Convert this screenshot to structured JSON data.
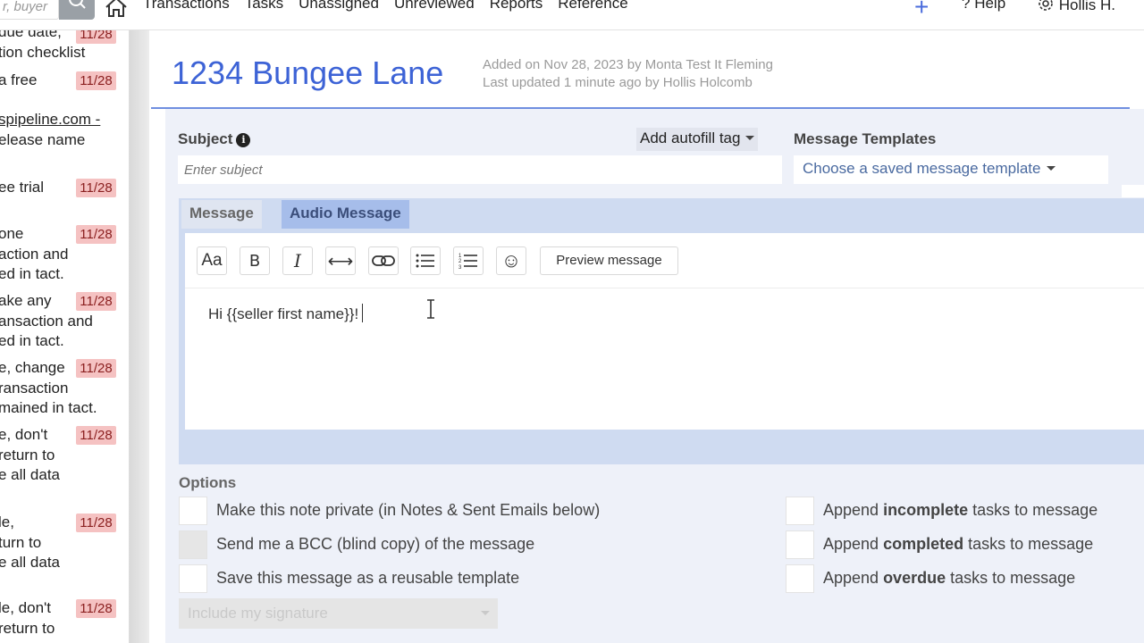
{
  "topnav": {
    "search_placeholder": "r, buyer",
    "links": [
      "Transactions",
      "Tasks",
      "Unassigned",
      "Unreviewed",
      "Reports",
      "Reference"
    ],
    "plus": "+",
    "help": "Help",
    "user": "Hollis H."
  },
  "task_list": [
    {
      "lines": [
        "due date,",
        "tion checklist"
      ],
      "date": "11/28"
    },
    {
      "lines": [
        "a free"
      ],
      "date": "11/28"
    },
    {
      "lines": [
        "spipeline.com -",
        "elease name"
      ],
      "date": ""
    },
    {
      "lines": [
        "ee trial"
      ],
      "date": "11/28"
    },
    {
      "lines": [
        "one",
        "action and",
        "ed in tact."
      ],
      "date": "11/28"
    },
    {
      "lines": [
        "ake any",
        "ansaction and",
        "ed in tact."
      ],
      "date": "11/28"
    },
    {
      "lines": [
        "e, change",
        "ransaction",
        "mained in tact."
      ],
      "date": "11/28"
    },
    {
      "lines": [
        "e, don't",
        "return to",
        "e all data"
      ],
      "date": "11/28"
    },
    {
      "lines": [
        "le,",
        "turn to",
        "e all data"
      ],
      "date": "11/28"
    },
    {
      "lines": [
        "le, don't",
        "return to"
      ],
      "date": "11/28"
    }
  ],
  "header": {
    "title": "1234 Bungee Lane",
    "added": "Added on Nov 28, 2023 by Monta Test It Fleming",
    "updated": "Last updated 1 minute ago by Hollis Holcomb"
  },
  "form": {
    "subject_label": "Subject",
    "autofill_label": "Add autofill tag",
    "subject_placeholder": "Enter subject",
    "templates_label": "Message Templates",
    "template_select": "Choose a saved message template",
    "tabs": [
      "Message",
      "Audio Message"
    ],
    "toolbar": {
      "preview": "Preview message",
      "font_glyph": "Aa",
      "bold_glyph": "B",
      "italic_glyph": "I",
      "resize_glyph": "⟷",
      "emoji_glyph": "☺"
    },
    "message_body": "Hi {{seller first name}}!"
  },
  "options": {
    "label": "Options",
    "left": [
      {
        "text": "Make this note private (in Notes & Sent Emails below)",
        "disabled": false
      },
      {
        "text": "Send me a BCC (blind copy) of the message",
        "disabled": true
      },
      {
        "text": "Save this message as a reusable template",
        "disabled": false
      }
    ],
    "right": [
      {
        "pre": "Append ",
        "bold": "incomplete",
        "post": " tasks to message"
      },
      {
        "pre": "Append ",
        "bold": "completed",
        "post": " tasks to message"
      },
      {
        "pre": "Append ",
        "bold": "overdue",
        "post": " tasks to message"
      }
    ],
    "signature": "Include my signature"
  },
  "colors": {
    "brand_blue": "#3d63d6",
    "badge_bg": "#f5c2c2",
    "form_bg": "#eef1f9",
    "message_bg": "#cfdbf1"
  }
}
